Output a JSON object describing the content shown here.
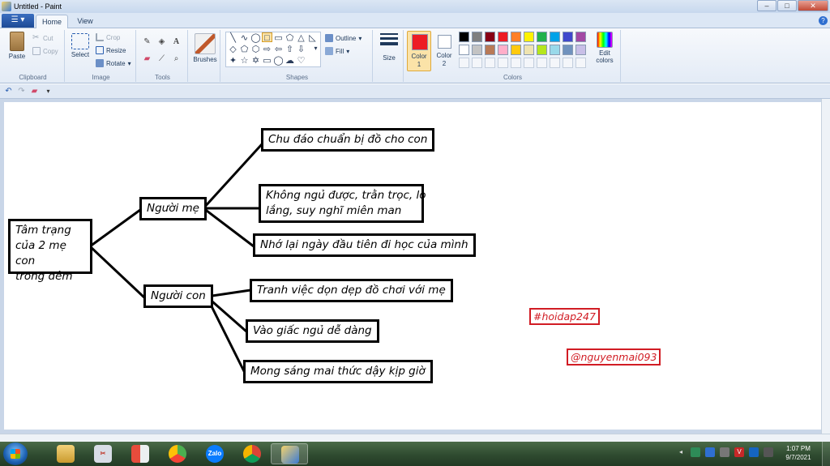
{
  "window": {
    "title": "Untitled - Paint",
    "minimize": "–",
    "maximize": "□",
    "close": "✕"
  },
  "tabs": {
    "file": "☰ ▾",
    "home": "Home",
    "view": "View",
    "help": "?"
  },
  "clipboard": {
    "paste": "Paste",
    "cut": "Cut",
    "copy": "Copy",
    "label": "Clipboard"
  },
  "image": {
    "select": "Select",
    "crop": "Crop",
    "resize": "Resize",
    "rotate": "Rotate",
    "label": "Image"
  },
  "tools": {
    "label": "Tools",
    "text_tool": "A",
    "brushes": "Brushes"
  },
  "shapes": {
    "outline": "Outline",
    "fill": "Fill",
    "label": "Shapes",
    "size": "Size"
  },
  "colors": {
    "color1_label": "Color",
    "color1_num": "1",
    "color2_label": "Color",
    "color2_num": "2",
    "edit_colors": "Edit colors",
    "label": "Colors",
    "color1": "#ed1c24",
    "color2": "#ffffff",
    "palette_row1": [
      "#000000",
      "#7f7f7f",
      "#880015",
      "#ed1c24",
      "#ff7f27",
      "#fff200",
      "#22b14c",
      "#00a2e8",
      "#3f48cc",
      "#a349a4"
    ],
    "palette_row2": [
      "#ffffff",
      "#c3c3c3",
      "#b97a57",
      "#ffaec9",
      "#ffc90e",
      "#efe4b0",
      "#b5e61d",
      "#99d9ea",
      "#7092be",
      "#c8bfe7"
    ]
  },
  "mindmap": {
    "root": "Tâm trạng của 2 mẹ con trong đêm",
    "root_lines": [
      "Tâm trạng",
      "của 2 mẹ con",
      "trong đêm"
    ],
    "mother": "Người mẹ",
    "mother_items": [
      "Chu đáo chuẩn bị đồ cho con",
      "Không ngủ được, trằn trọc, lo",
      "lắng, suy nghĩ miên man",
      "Nhớ lại ngày đầu tiên đi học của mình"
    ],
    "child": "Người con",
    "child_items": [
      "Tranh việc dọn dẹp đồ chơi với mẹ",
      "Vào giấc ngủ dễ dàng",
      "Mong sáng mai thức dậy kịp giờ"
    ]
  },
  "tags": {
    "tag1": "#hoidap247",
    "tag2": "@nguyenmai093"
  },
  "taskbar": {
    "clock_time": "1:07 PM",
    "clock_date": "9/7/2021",
    "zalo": "Zalo"
  }
}
